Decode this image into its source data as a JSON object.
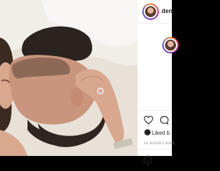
{
  "header": {
    "username": "den"
  },
  "post": {
    "photo_alt": "couple-photo"
  },
  "actions": {
    "like": "heart-icon",
    "comment": "comment-icon"
  },
  "likes": {
    "label": "Liked b"
  },
  "timestamp": "14 HOURS AGO",
  "comment_box": {
    "emoji": "smiley-icon"
  },
  "colors": {
    "panel_bg": "#ffffff",
    "text": "#262626",
    "muted": "#8e8e8e",
    "border": "#efefef"
  }
}
